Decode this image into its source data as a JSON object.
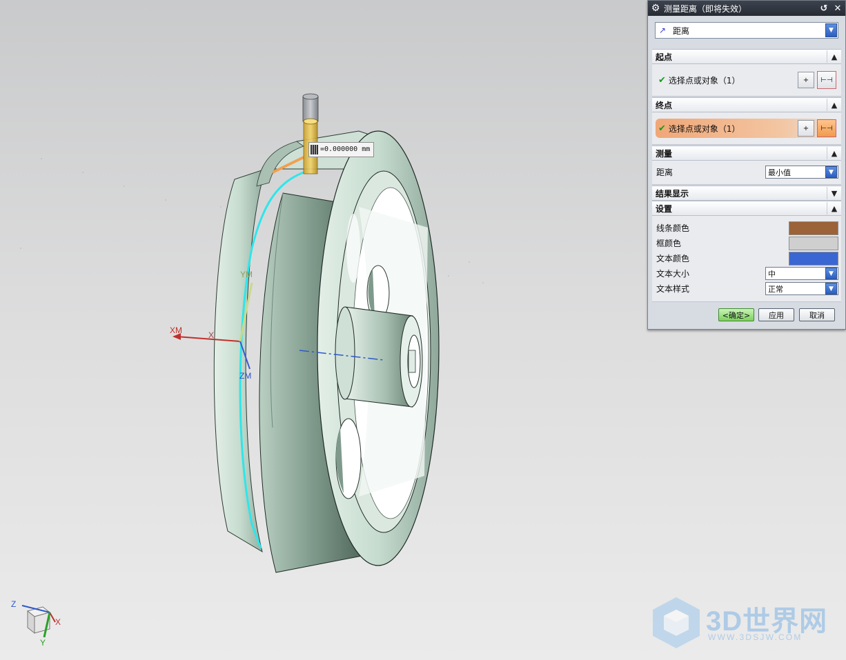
{
  "dialog": {
    "title": "测量距离（即将失效）",
    "type_value": "距离",
    "start_section": "起点",
    "start_select": "选择点或对象（1）",
    "end_section": "终点",
    "end_select": "选择点或对象（1）",
    "measure_section": "测量",
    "distance_label": "距离",
    "distance_value": "最小值",
    "results_section": "结果显示",
    "settings_section": "设置",
    "line_color_label": "线条颜色",
    "box_color_label": "框颜色",
    "text_color_label": "文本颜色",
    "text_size_label": "文本大小",
    "text_size_value": "中",
    "text_style_label": "文本样式",
    "text_style_value": "正常",
    "ok_label": "<确定>",
    "apply_label": "应用",
    "cancel_label": "取消",
    "colors": {
      "line": "#9b6337",
      "box": "#cfcfcf",
      "text": "#3a66d4"
    }
  },
  "viewport": {
    "measure_readout": "=0.000000 mm",
    "axis_labels": {
      "xm": "XM",
      "x": "X",
      "ym": "YM",
      "zm": "ZM"
    },
    "triad_labels": {
      "z": "Z",
      "x": "X",
      "y": "Y"
    }
  },
  "watermark": {
    "brand": "3D世界网",
    "url": "WWW.3DSJW.COM"
  }
}
